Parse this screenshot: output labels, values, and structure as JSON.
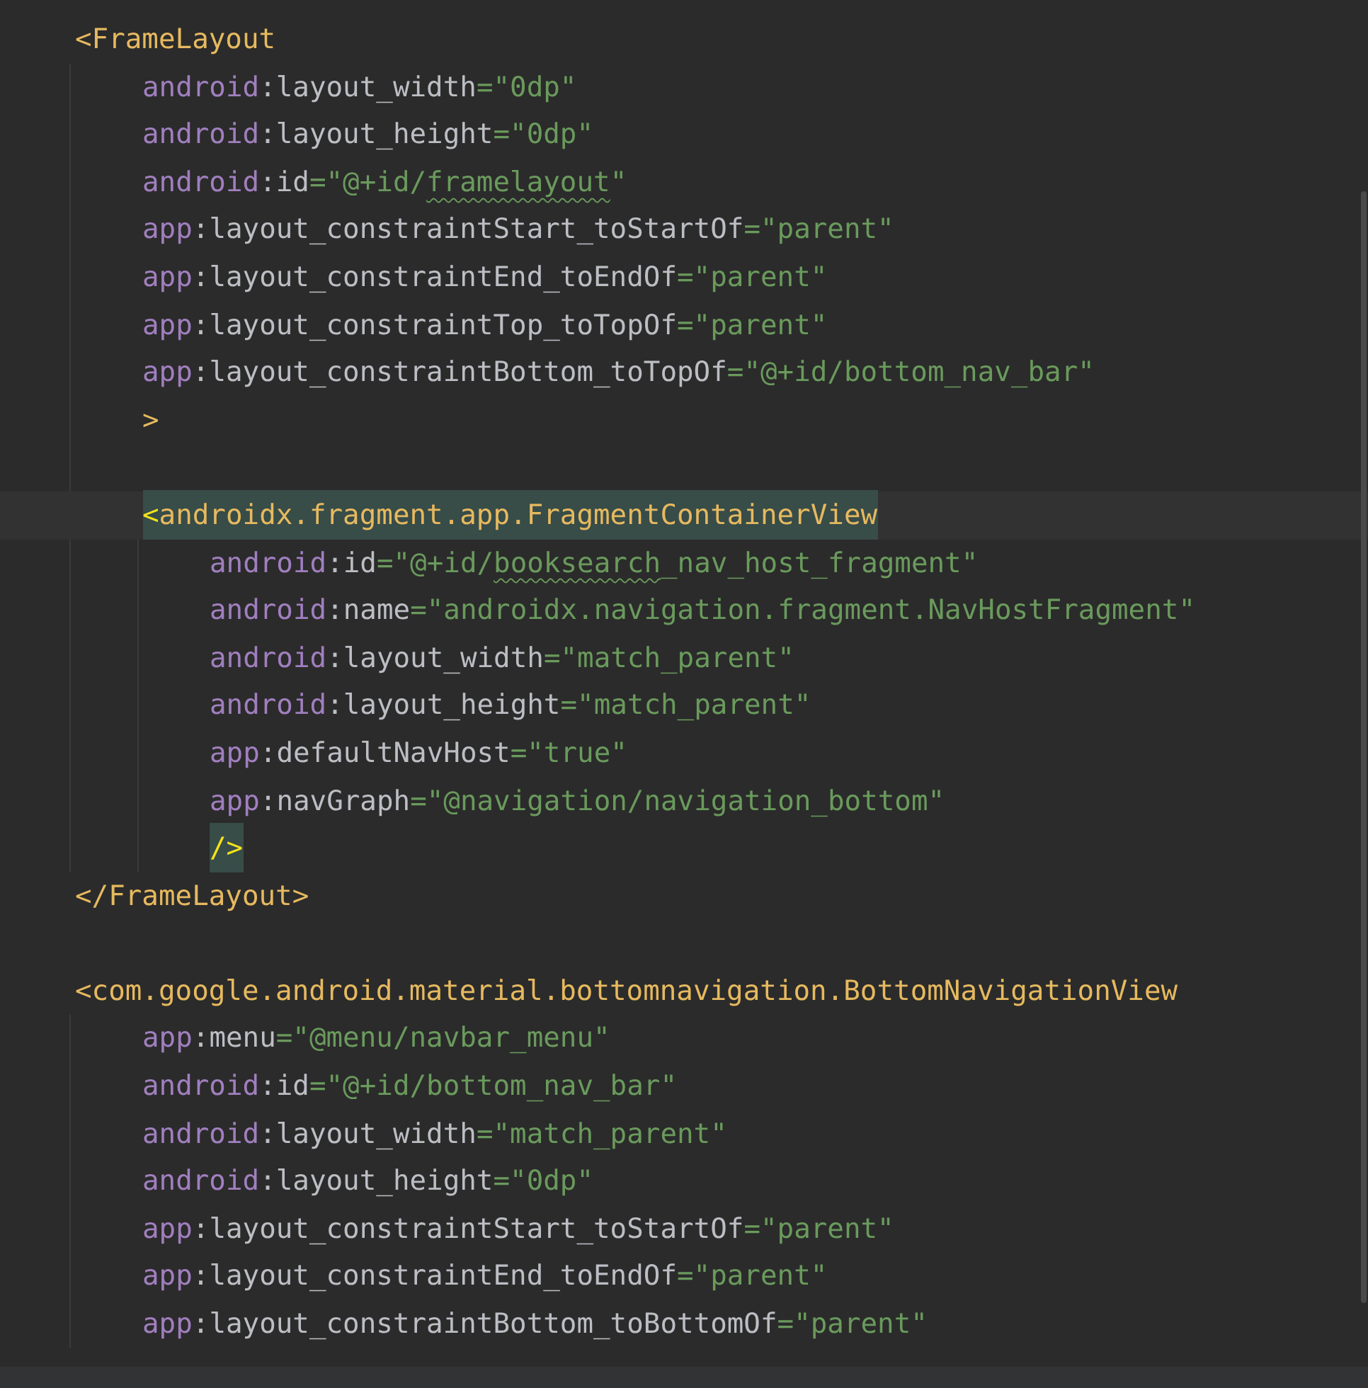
{
  "editor": {
    "elements": [
      {
        "open": [
          {
            "kind": "tag",
            "text": "<FrameLayout"
          }
        ],
        "current": false,
        "matched": false,
        "attributes": [
          [
            {
              "kind": "ns",
              "text": "android"
            },
            {
              "kind": "punct",
              "text": ":"
            },
            {
              "kind": "attr",
              "text": "layout_width"
            },
            {
              "kind": "eq",
              "text": "="
            },
            {
              "kind": "value",
              "text": "\"0dp\""
            }
          ],
          [
            {
              "kind": "ns",
              "text": "android"
            },
            {
              "kind": "punct",
              "text": ":"
            },
            {
              "kind": "attr",
              "text": "layout_height"
            },
            {
              "kind": "eq",
              "text": "="
            },
            {
              "kind": "value",
              "text": "\"0dp\""
            }
          ],
          [
            {
              "kind": "ns",
              "text": "android"
            },
            {
              "kind": "punct",
              "text": ":"
            },
            {
              "kind": "attr",
              "text": "id"
            },
            {
              "kind": "eq",
              "text": "="
            },
            {
              "kind": "value",
              "text": "\"@+id/"
            },
            {
              "kind": "typo",
              "text": "framelayout"
            },
            {
              "kind": "value",
              "text": "\""
            }
          ],
          [
            {
              "kind": "ns",
              "text": "app"
            },
            {
              "kind": "punct",
              "text": ":"
            },
            {
              "kind": "attr",
              "text": "layout_constraintStart_toStartOf"
            },
            {
              "kind": "eq",
              "text": "="
            },
            {
              "kind": "value",
              "text": "\"parent\""
            }
          ],
          [
            {
              "kind": "ns",
              "text": "app"
            },
            {
              "kind": "punct",
              "text": ":"
            },
            {
              "kind": "attr",
              "text": "layout_constraintEnd_toEndOf"
            },
            {
              "kind": "eq",
              "text": "="
            },
            {
              "kind": "value",
              "text": "\"parent\""
            }
          ],
          [
            {
              "kind": "ns",
              "text": "app"
            },
            {
              "kind": "punct",
              "text": ":"
            },
            {
              "kind": "attr",
              "text": "layout_constraintTop_toTopOf"
            },
            {
              "kind": "eq",
              "text": "="
            },
            {
              "kind": "value",
              "text": "\"parent\""
            }
          ],
          [
            {
              "kind": "ns",
              "text": "app"
            },
            {
              "kind": "punct",
              "text": ":"
            },
            {
              "kind": "attr",
              "text": "layout_constraintBottom_toTopOf"
            },
            {
              "kind": "eq",
              "text": "="
            },
            {
              "kind": "value",
              "text": "\"@+id/bottom_nav_bar\""
            }
          ]
        ],
        "end": [
          {
            "kind": "tag",
            "text": ">"
          }
        ],
        "children": [
          {
            "open": [
              {
                "kind": "brace",
                "text": "<"
              },
              {
                "kind": "tag",
                "text": "androidx.fragment.app.FragmentContainerView"
              }
            ],
            "current": true,
            "matched": true,
            "attributes": [
              [
                {
                  "kind": "ns",
                  "text": "android"
                },
                {
                  "kind": "punct",
                  "text": ":"
                },
                {
                  "kind": "attr",
                  "text": "id"
                },
                {
                  "kind": "eq",
                  "text": "="
                },
                {
                  "kind": "value",
                  "text": "\"@+id/"
                },
                {
                  "kind": "typo",
                  "text": "booksearch"
                },
                {
                  "kind": "value",
                  "text": "_nav_host_fragment\""
                }
              ],
              [
                {
                  "kind": "ns",
                  "text": "android"
                },
                {
                  "kind": "punct",
                  "text": ":"
                },
                {
                  "kind": "attr",
                  "text": "name"
                },
                {
                  "kind": "eq",
                  "text": "="
                },
                {
                  "kind": "value",
                  "text": "\"androidx.navigation.fragment.NavHostFragment\""
                }
              ],
              [
                {
                  "kind": "ns",
                  "text": "android"
                },
                {
                  "kind": "punct",
                  "text": ":"
                },
                {
                  "kind": "attr",
                  "text": "layout_width"
                },
                {
                  "kind": "eq",
                  "text": "="
                },
                {
                  "kind": "value",
                  "text": "\"match_parent\""
                }
              ],
              [
                {
                  "kind": "ns",
                  "text": "android"
                },
                {
                  "kind": "punct",
                  "text": ":"
                },
                {
                  "kind": "attr",
                  "text": "layout_height"
                },
                {
                  "kind": "eq",
                  "text": "="
                },
                {
                  "kind": "value",
                  "text": "\"match_parent\""
                }
              ],
              [
                {
                  "kind": "ns",
                  "text": "app"
                },
                {
                  "kind": "punct",
                  "text": ":"
                },
                {
                  "kind": "attr",
                  "text": "defaultNavHost"
                },
                {
                  "kind": "eq",
                  "text": "="
                },
                {
                  "kind": "value",
                  "text": "\"true\""
                }
              ],
              [
                {
                  "kind": "ns",
                  "text": "app"
                },
                {
                  "kind": "punct",
                  "text": ":"
                },
                {
                  "kind": "attr",
                  "text": "navGraph"
                },
                {
                  "kind": "eq",
                  "text": "="
                },
                {
                  "kind": "value",
                  "text": "\"@navigation/navigation_bottom\""
                }
              ]
            ],
            "end": [
              {
                "kind": "brace",
                "text": "/>"
              }
            ]
          }
        ],
        "close": [
          {
            "kind": "tag",
            "text": "</FrameLayout>"
          }
        ]
      },
      {
        "open": [
          {
            "kind": "tag",
            "text": "<com.google.android.material.bottomnavigation.BottomNavigationView"
          }
        ],
        "current": false,
        "matched": false,
        "attributes": [
          [
            {
              "kind": "ns",
              "text": "app"
            },
            {
              "kind": "punct",
              "text": ":"
            },
            {
              "kind": "attr",
              "text": "menu"
            },
            {
              "kind": "eq",
              "text": "="
            },
            {
              "kind": "value",
              "text": "\"@menu/navbar_menu\""
            }
          ],
          [
            {
              "kind": "ns",
              "text": "android"
            },
            {
              "kind": "punct",
              "text": ":"
            },
            {
              "kind": "attr",
              "text": "id"
            },
            {
              "kind": "eq",
              "text": "="
            },
            {
              "kind": "value",
              "text": "\"@+id/bottom_nav_bar\""
            }
          ],
          [
            {
              "kind": "ns",
              "text": "android"
            },
            {
              "kind": "punct",
              "text": ":"
            },
            {
              "kind": "attr",
              "text": "layout_width"
            },
            {
              "kind": "eq",
              "text": "="
            },
            {
              "kind": "value",
              "text": "\"match_parent\""
            }
          ],
          [
            {
              "kind": "ns",
              "text": "android"
            },
            {
              "kind": "punct",
              "text": ":"
            },
            {
              "kind": "attr",
              "text": "layout_height"
            },
            {
              "kind": "eq",
              "text": "="
            },
            {
              "kind": "value",
              "text": "\"0dp\""
            }
          ],
          [
            {
              "kind": "ns",
              "text": "app"
            },
            {
              "kind": "punct",
              "text": ":"
            },
            {
              "kind": "attr",
              "text": "layout_constraintStart_toStartOf"
            },
            {
              "kind": "eq",
              "text": "="
            },
            {
              "kind": "value",
              "text": "\"parent\""
            }
          ],
          [
            {
              "kind": "ns",
              "text": "app"
            },
            {
              "kind": "punct",
              "text": ":"
            },
            {
              "kind": "attr",
              "text": "layout_constraintEnd_toEndOf"
            },
            {
              "kind": "eq",
              "text": "="
            },
            {
              "kind": "value",
              "text": "\"parent\""
            }
          ],
          [
            {
              "kind": "ns",
              "text": "app"
            },
            {
              "kind": "punct",
              "text": ":"
            },
            {
              "kind": "attr",
              "text": "layout_constraintBottom_toBottomOf"
            },
            {
              "kind": "eq",
              "text": "="
            },
            {
              "kind": "value",
              "text": "\"parent\""
            }
          ]
        ]
      }
    ]
  }
}
